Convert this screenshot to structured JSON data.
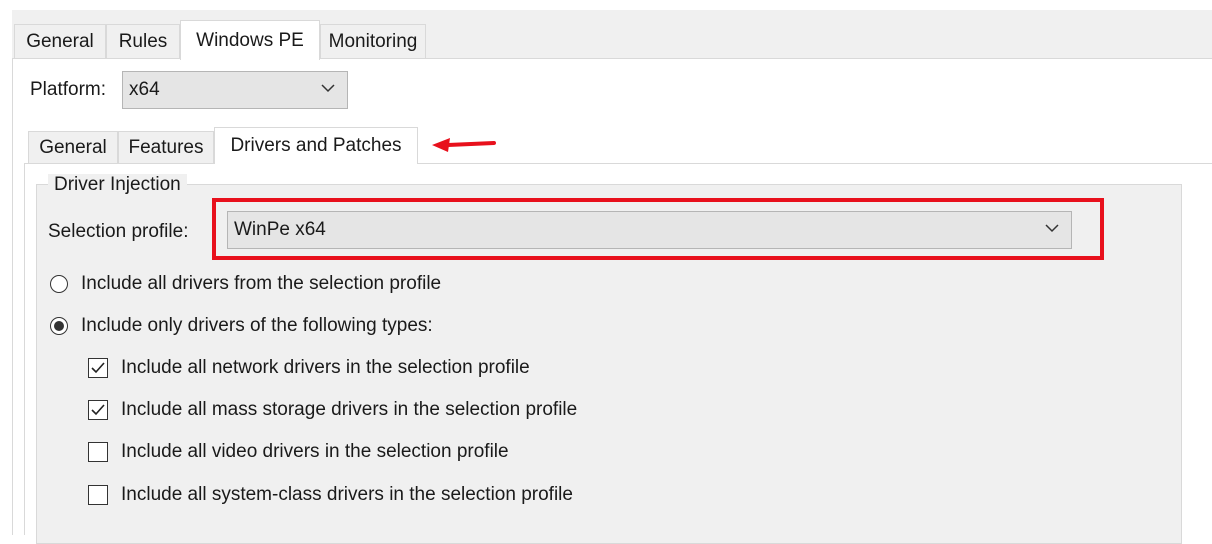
{
  "outer_tabs": [
    "General",
    "Rules",
    "Windows PE",
    "Monitoring"
  ],
  "platform": {
    "label": "Platform:",
    "value": "x64"
  },
  "inner_tabs": [
    "General",
    "Features",
    "Drivers and Patches"
  ],
  "driver_injection": {
    "group_title": "Driver Injection",
    "selection_profile_label": "Selection profile:",
    "selection_profile_value": "WinPe x64",
    "radio_all": {
      "label": "Include all drivers from the selection profile",
      "selected": false
    },
    "radio_only": {
      "label": "Include only drivers of the following types:",
      "selected": true
    },
    "checks": [
      {
        "label": "Include all network drivers in the selection profile",
        "checked": true
      },
      {
        "label": "Include all mass storage drivers in the selection profile",
        "checked": true
      },
      {
        "label": "Include all video drivers in the selection profile",
        "checked": false
      },
      {
        "label": "Include all system-class drivers in the selection profile",
        "checked": false
      }
    ]
  },
  "colors": {
    "highlight": "#e8101c",
    "panel": "#f0f0f0",
    "border": "#d9d9d9"
  }
}
